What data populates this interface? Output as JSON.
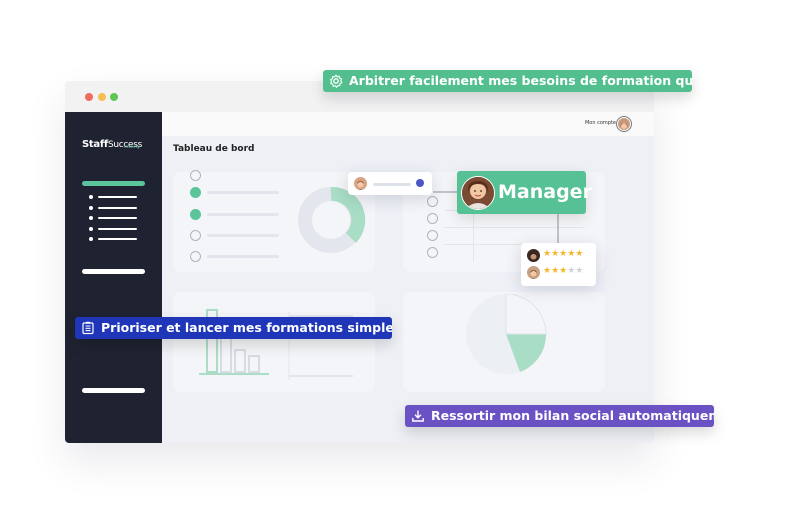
{
  "window": {
    "traffic_lights": [
      "#ee6b5d",
      "#f6be50",
      "#61c554"
    ]
  },
  "sidebar": {
    "logo_staff": "Staff",
    "logo_success": "Success",
    "logo_tagline": "training",
    "accent": "#5bc49a",
    "background": "#1f2230"
  },
  "header": {
    "account_label": "Mon compte"
  },
  "main": {
    "page_title": "Tableau de bord"
  },
  "callouts": {
    "arbitrer": {
      "text": "Arbitrer facilement mes besoins de formation qualité",
      "icon": "gear-icon",
      "color": "#53bf8f"
    },
    "prioriser": {
      "text": "Prioriser et lancer mes formations simplement",
      "icon": "list-icon",
      "color": "#1f36b8"
    },
    "ressortir": {
      "text": "Ressortir mon bilan social automatiquement",
      "icon": "download-icon",
      "color": "#6a52c4"
    }
  },
  "manager_card": {
    "label": "Manager"
  },
  "ratings": [
    {
      "stars": 5,
      "max": 5
    },
    {
      "stars": 3,
      "max": 5
    }
  ],
  "star_color": "#f5b731"
}
